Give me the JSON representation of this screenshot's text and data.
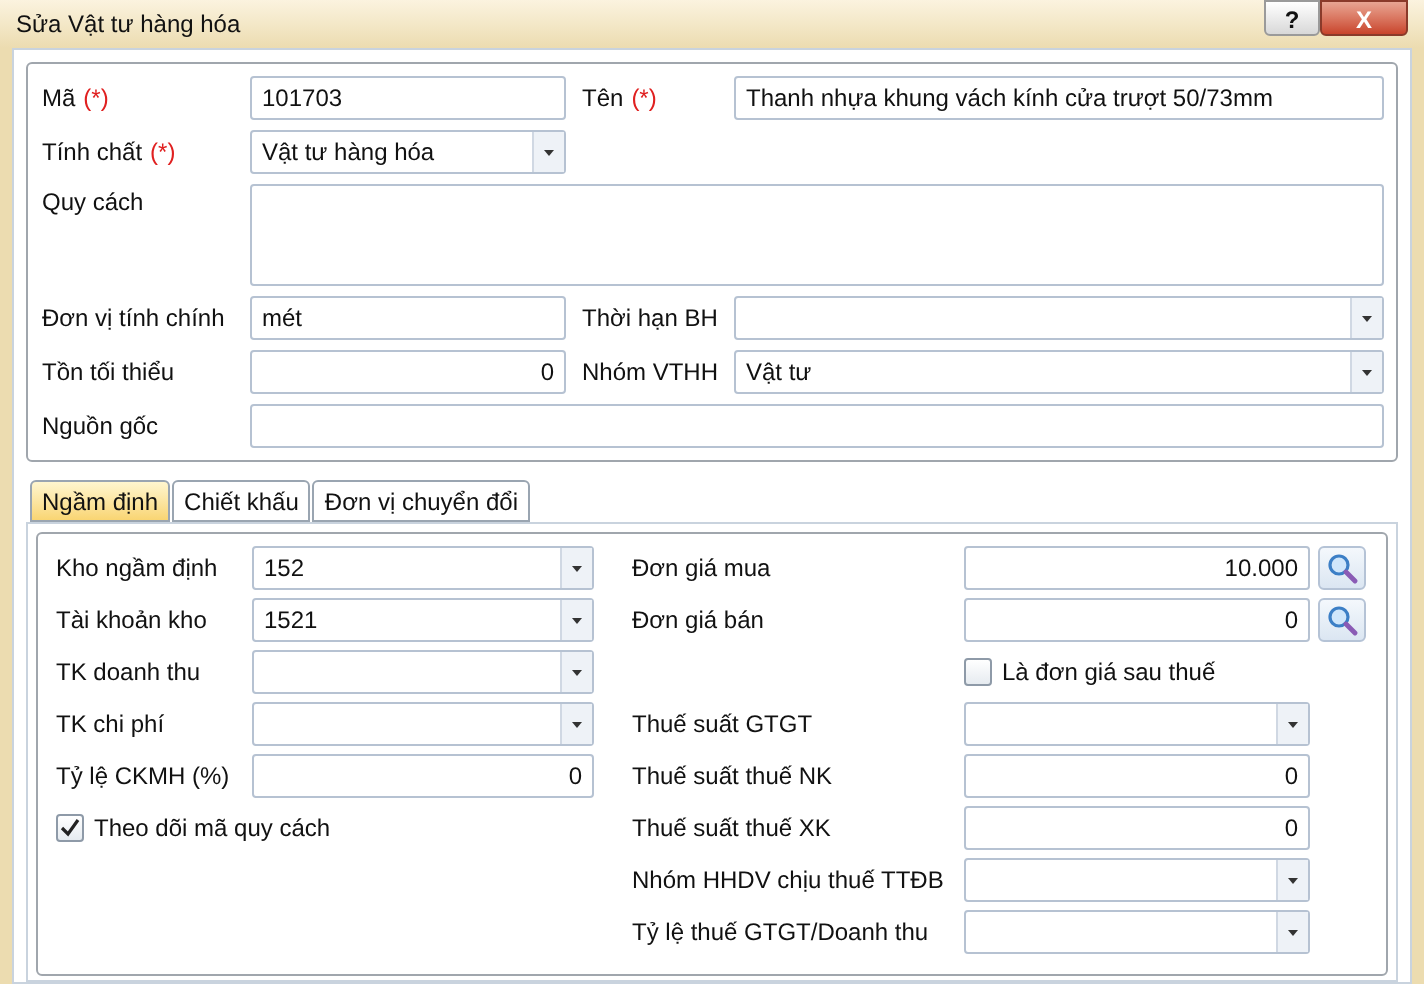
{
  "window": {
    "title": "Sửa Vật tư hàng hóa",
    "help_button": "?",
    "close_button": "X"
  },
  "general": {
    "rows": [
      [
        {
          "label": "Mã",
          "required_mark": "(*)",
          "kind": "text",
          "value": "101703"
        },
        {
          "label": "Tên",
          "required_mark": "(*)",
          "kind": "text",
          "value": "Thanh nhựa khung vách kính cửa trượt 50/73mm"
        }
      ],
      [
        {
          "label": "Tính chất",
          "required_mark": "(*)",
          "kind": "combo",
          "value": "Vật tư hàng hóa"
        }
      ],
      [
        {
          "label": "Quy cách",
          "kind": "area"
        }
      ],
      [
        {
          "label": "Đơn vị tính chính",
          "kind": "text",
          "value": "mét"
        },
        {
          "label": "Thời hạn BH",
          "kind": "combo"
        }
      ],
      [
        {
          "label": "Tồn tối thiểu",
          "kind": "number",
          "value": "0"
        },
        {
          "label": "Nhóm VTHH",
          "kind": "combo",
          "value": "Vật tư"
        }
      ],
      [
        {
          "label": "Nguồn gốc",
          "kind": "text"
        }
      ]
    ]
  },
  "tabs": [
    {
      "label": "Ngầm định",
      "selected": true
    },
    {
      "label": "Chiết khấu",
      "selected": false
    },
    {
      "label": "Đơn vị chuyển đổi",
      "selected": false
    }
  ],
  "defaults": {
    "left": [
      {
        "label": "Kho ngầm định",
        "kind": "combo",
        "value": "152"
      },
      {
        "label": "Tài khoản kho",
        "kind": "combo",
        "value": "1521"
      },
      {
        "label": "TK doanh thu",
        "kind": "combo"
      },
      {
        "label": "TK chi phí",
        "kind": "combo"
      },
      {
        "label": "Tỷ lệ CKMH (%)",
        "kind": "number",
        "value": "0"
      },
      {
        "label": "Theo dõi mã quy cách",
        "kind": "checkbox",
        "checked": true
      }
    ],
    "right": [
      {
        "label": "Đơn giá mua",
        "kind": "number_search",
        "value": "10.000"
      },
      {
        "label": "Đơn giá bán",
        "kind": "number_search",
        "value": "0"
      },
      {
        "label": "Là đơn giá sau thuế",
        "kind": "checkbox",
        "checked": false
      },
      {
        "label": "Thuế suất GTGT",
        "kind": "combo"
      },
      {
        "label": "Thuế suất thuế NK",
        "kind": "number",
        "value": "0"
      },
      {
        "label": "Thuế suất thuế XK",
        "kind": "number",
        "value": "0"
      },
      {
        "label": "Nhóm HHDV chịu thuế TTĐB",
        "kind": "combo"
      },
      {
        "label": "Tỷ lệ thuế GTGT/Doanh thu",
        "kind": "combo"
      }
    ]
  }
}
